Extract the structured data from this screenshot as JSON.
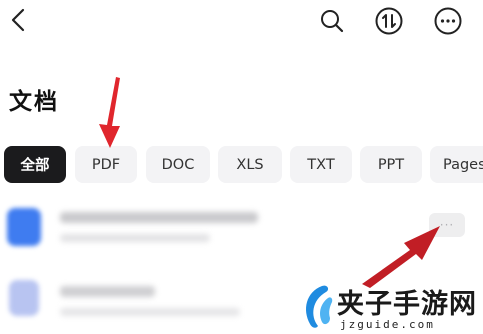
{
  "page": {
    "title": "文档"
  },
  "toolbar": {
    "back_icon": "chevron-left-icon",
    "search_icon": "search-icon",
    "sort_icon": "sort-arrows-icon",
    "more_icon": "more-horizontal-icon"
  },
  "filters": [
    {
      "label": "全部",
      "active": true
    },
    {
      "label": "PDF",
      "active": false
    },
    {
      "label": "DOC",
      "active": false
    },
    {
      "label": "XLS",
      "active": false
    },
    {
      "label": "TXT",
      "active": false
    },
    {
      "label": "PPT",
      "active": false
    },
    {
      "label": "Pages",
      "active": false
    }
  ],
  "files": [
    {
      "icon": "document-icon",
      "icon_color": "#3f7cf0",
      "more_glyph": "···"
    },
    {
      "icon": "document-icon",
      "icon_color": "#7f95e6"
    }
  ],
  "annotations": {
    "arrow_color": "#e0262d"
  },
  "watermark": {
    "text": "夹子手游网",
    "url": "jzguide.com"
  }
}
